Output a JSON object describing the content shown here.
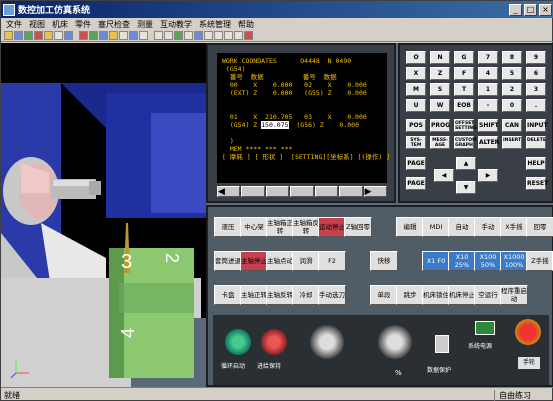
{
  "window": {
    "title": "数控加工仿真系统"
  },
  "menu": [
    "文件",
    "视图",
    "机床",
    "零件",
    "塞尺检查",
    "测量",
    "互动教学",
    "系统管理",
    "帮助"
  ],
  "screen": {
    "line1": "WORK COONDATES      O4448  N 0490",
    "line2": " (G54)",
    "line3": "  番号  数据          番号  数据",
    "line4": "  00    X    0.000   02    X    0.000",
    "line5": "  (EXT) Z    0.000   (G55) Z    0.000",
    "line6": "  01    X  210.705   03    X    0.000",
    "line7": "  (G54) Z ",
    "cursor_val": "150.075",
    "line7b": "  (G56) Z    0.000",
    "line8": "  MEM **** *** ***",
    "softkeys": "[ 摩耗 ] [ 形状 ]  [SETTING][坐标系] [(操作) ]"
  },
  "keys": [
    [
      "O",
      "N",
      "G",
      "7",
      "8",
      "9"
    ],
    [
      "X",
      "Z",
      "F",
      "4",
      "5",
      "6"
    ],
    [
      "M",
      "S",
      "T",
      "1",
      "2",
      "3"
    ],
    [
      "U",
      "W",
      "EOB",
      "-",
      "0",
      "."
    ]
  ],
  "func_keys": [
    [
      "POS",
      "PROG",
      "OFFSET SETTING",
      "SHIFT",
      "CAN",
      "INPUT"
    ],
    [
      "SYS-TEM",
      "MESS-AGE",
      "CUSTOM GRAPH",
      "ALTER",
      "INSERT",
      "DELETE"
    ]
  ],
  "nav_keys": {
    "page_up": "PAGE",
    "page_dn": "PAGE",
    "help": "HELP",
    "reset": "RESET"
  },
  "ops": {
    "row1": [
      "液压",
      "中心架",
      "主轴箱正转",
      "主轴箱反转",
      "运动停止",
      "Z轴回零",
      "",
      "编辑",
      "MDI",
      "自动",
      "手动",
      "X手摇",
      "回零"
    ],
    "row2": [
      "套筒进退",
      "主轴停止",
      "主轴点动",
      "润滑",
      "F2",
      "",
      "快移",
      "",
      "X1 F0",
      "X10 25%",
      "X100 50%",
      "X1000 100%",
      "Z手摇",
      "F1"
    ],
    "row3": [
      "卡盘",
      "主轴正转",
      "主轴反转",
      "冷却",
      "手动选刀",
      "",
      "单段",
      "跳步",
      "机床锁住",
      "机床停止",
      "空运行",
      "程序重启动"
    ],
    "lower": {
      "cycle_start": "循环启动",
      "feed_hold": "进给保持",
      "override": "%",
      "data_protect": "数据保护",
      "sys_power": "系统电源",
      "hand": "手轮"
    }
  },
  "status": {
    "left": "就绪",
    "right": "自由练习"
  }
}
